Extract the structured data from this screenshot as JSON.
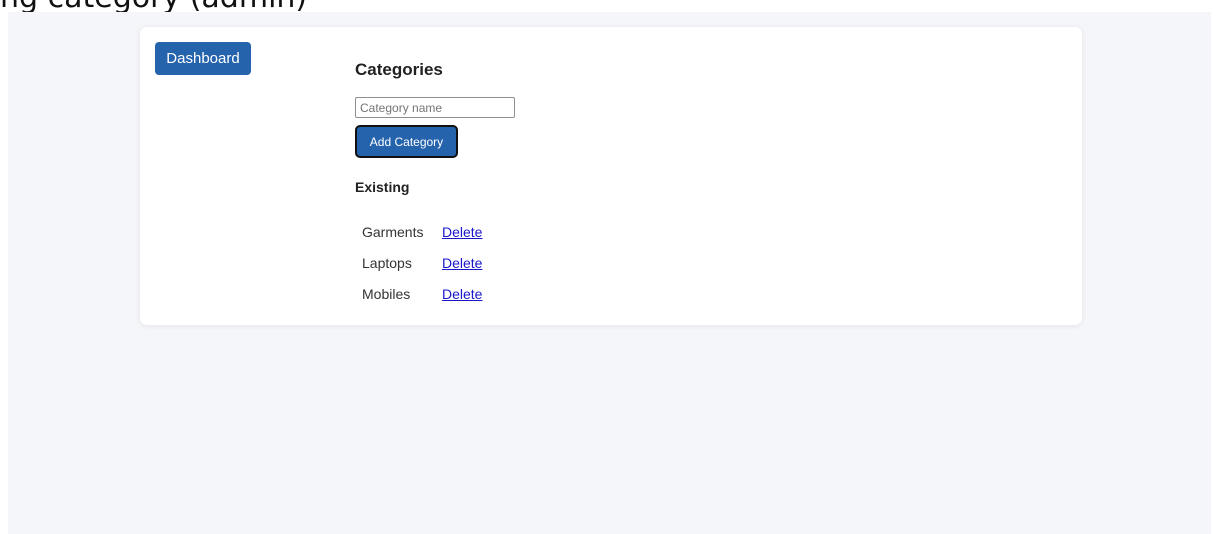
{
  "caption": "ng category (admin)",
  "nav": {
    "dashboard_label": "Dashboard"
  },
  "page": {
    "title": "Categories",
    "input_placeholder": "Category name",
    "add_label": "Add Category",
    "existing_heading": "Existing"
  },
  "categories": [
    {
      "name": "Garments",
      "action": "Delete"
    },
    {
      "name": "Laptops",
      "action": "Delete"
    },
    {
      "name": "Mobiles",
      "action": "Delete"
    }
  ],
  "colors": {
    "primary": "#2563ad",
    "link": "#1a16c9",
    "background": "#f5f6f9",
    "card": "#ffffff"
  }
}
